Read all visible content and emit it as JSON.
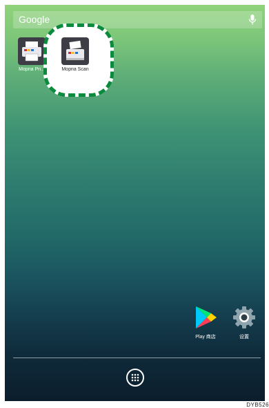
{
  "search": {
    "label": "Google"
  },
  "apps": {
    "mopria_print": {
      "label": "Mopria Pri..."
    },
    "mopria_scan": {
      "label": "Mopria Scan"
    },
    "play_store": {
      "label": "Play 商店"
    },
    "settings": {
      "label": "设置"
    }
  },
  "footer": {
    "code": "DYB526"
  },
  "colors": {
    "highlight": "#0a8a3c"
  },
  "icons": {
    "mic": "mic-icon",
    "print": "printer-icon",
    "scan": "scanner-icon",
    "play": "play-store-icon",
    "settings": "gear-icon",
    "drawer": "app-drawer-icon"
  }
}
